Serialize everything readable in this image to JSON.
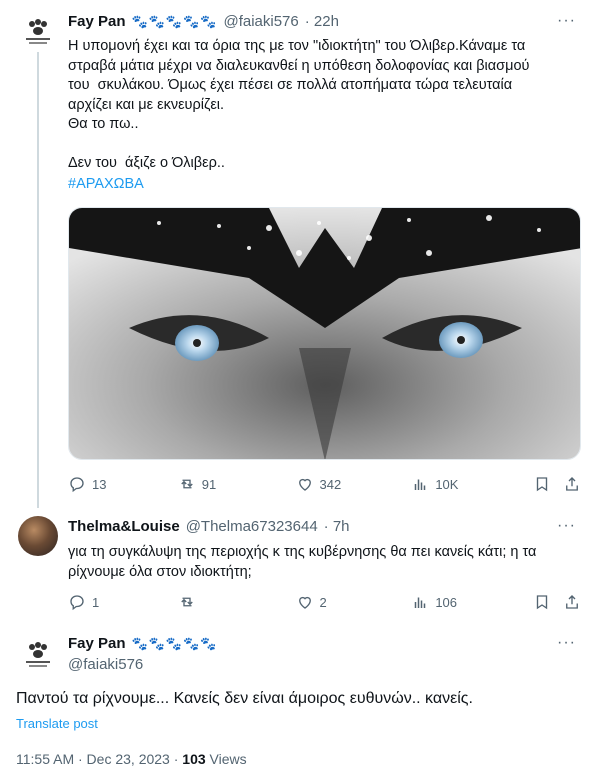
{
  "tweet1": {
    "name": "Fay Pan",
    "paws": "🐾🐾🐾🐾🐾",
    "handle": "@faiaki576",
    "time": "· 22h",
    "text": "Η υπομονή έχει και τα όρια της με τον \"ιδιοκτήτη\" του Όλιβερ.Κάναμε τα\nστραβά μάτια μέχρι να διαλευκανθεί η υπόθεση δολοφονίας και βιασμού\nτου  σκυλάκου. Όμως έχει πέσει σε πολλά ατοπήματα τώρα τελευταία\nαρχίζει και με εκνευρίζει.\nΘα το πω..\n\nΔεν του  άξιζε ο Όλιβερ..",
    "hashtag": "#ΑΡΑΧΩΒΑ",
    "replies": "13",
    "retweets": "91",
    "likes": "342",
    "views": "10K"
  },
  "tweet2": {
    "name": "Thelma&Louise",
    "handle": "@Thelma67323644",
    "time": "· 7h",
    "text": "για τη συγκάλυψη της περιοχής κ της κυβέρνησης θα πει κανείς κάτι; η τα\nρίχνουμε όλα στον ιδιοκτήτη;",
    "replies": "1",
    "likes": "2",
    "views": "106"
  },
  "tweet3": {
    "name": "Fay Pan",
    "paws": "🐾🐾🐾🐾🐾",
    "handle": "@faiaki576",
    "text": "Παντού τα ρίχνουμε... Κανείς δεν είναι άμοιρος ευθυνών.. κανείς.",
    "translate": "Translate post",
    "timestamp": "11:55 AM · Dec 23, 2023 · ",
    "views_count": "103",
    "views_label": " Views"
  },
  "more_icon": "···",
  "colors": {
    "link": "#1d9bf0",
    "muted": "#536471",
    "text": "#0f1419",
    "paw": "#8b1a1a"
  }
}
